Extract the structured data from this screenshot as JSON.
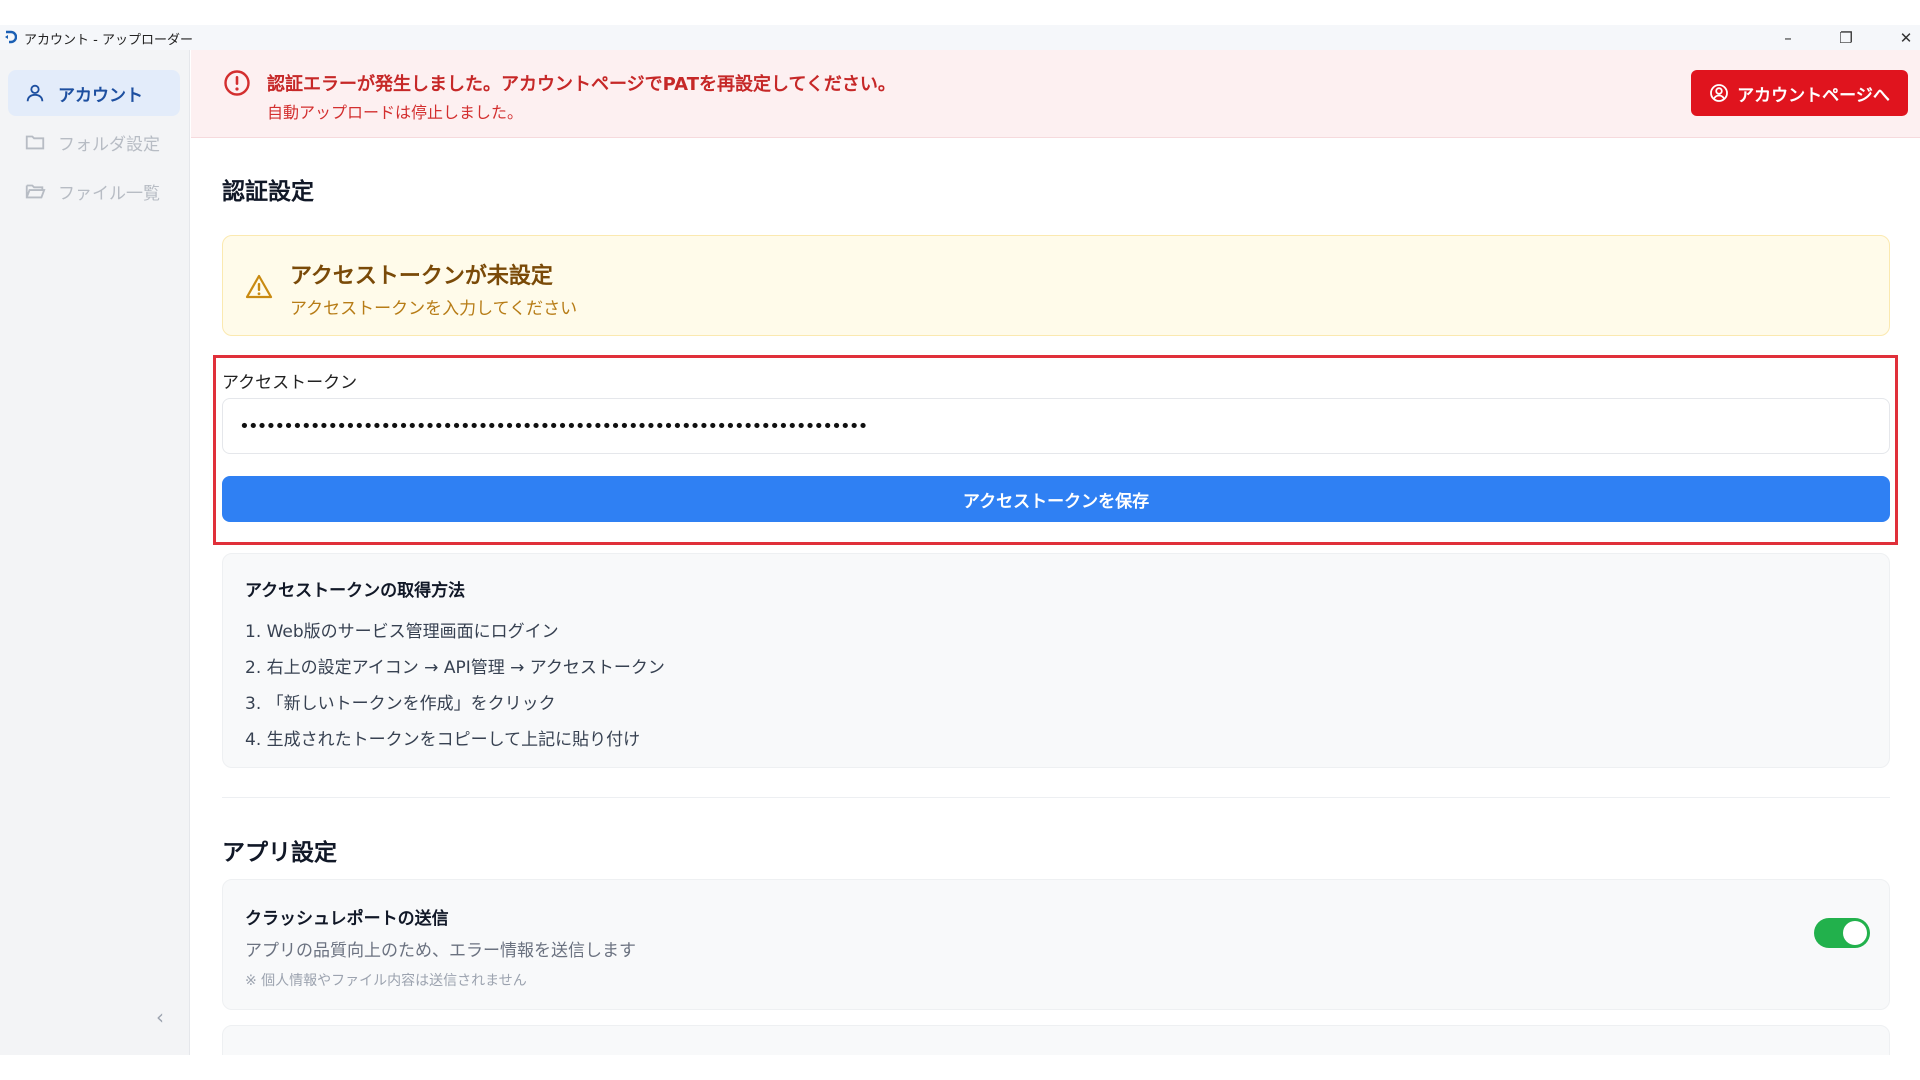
{
  "window": {
    "title": "アカウント - アップローダー",
    "controls": [
      "–",
      "❐",
      "✕"
    ]
  },
  "sidebar": {
    "items": [
      {
        "label": "アカウント",
        "icon": "user-icon",
        "active": true
      },
      {
        "label": "フォルダ設定",
        "icon": "folder-icon",
        "active": false
      },
      {
        "label": "ファイル一覧",
        "icon": "folder-open-icon",
        "active": false
      }
    ],
    "collapse_glyph": "‹"
  },
  "error_banner": {
    "line1": "認証エラーが発生しました。アカウントページでPATを再設定してください。",
    "line2": "自動アップロードは停止しました。",
    "button_label": "アカウントページへ"
  },
  "auth_section": {
    "title": "認証設定",
    "warning": {
      "title": "アクセストークンが未設定",
      "subtitle": "アクセストークンを入力してください"
    },
    "token_label": "アクセストークン",
    "token_value": "•••••••••••••••••••••••••••••••••••••••••••••••••••••••••••••••••••••••",
    "save_button": "アクセストークンを保存",
    "howto": {
      "title": "アクセストークンの取得方法",
      "steps": [
        "1. Web版のサービス管理画面にログイン",
        "2. 右上の設定アイコン → API管理 → アクセストークン",
        "3. 「新しいトークンを作成」をクリック",
        "4. 生成されたトークンをコピーして上記に貼り付け"
      ]
    }
  },
  "app_section": {
    "title": "アプリ設定",
    "crash_report": {
      "title": "クラッシュレポートの送信",
      "description": "アプリの品質向上のため、エラー情報を送信します",
      "note": "※ 個人情報やファイル内容は送信されません",
      "enabled": true
    }
  },
  "colors": {
    "accent": "#2f80f3",
    "error": "#e0141e",
    "warning": "#b77c16",
    "toggle_on": "#22b14c"
  }
}
